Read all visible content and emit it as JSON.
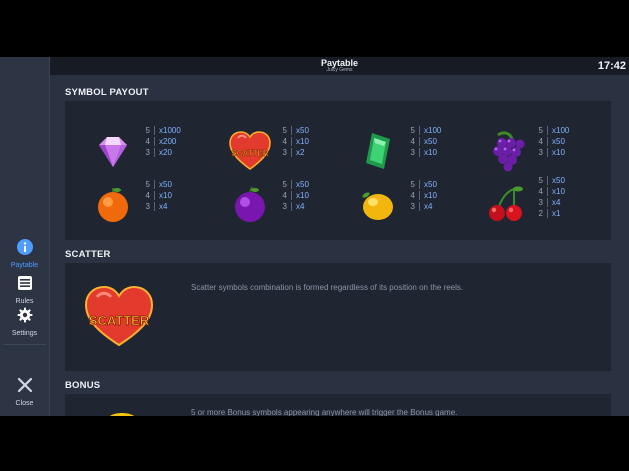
{
  "header": {
    "title": "Paytable",
    "subtitle": "Juicy Gems",
    "time": "17:42"
  },
  "sidebar": {
    "items": [
      {
        "label": "Paytable",
        "icon": "info-icon"
      },
      {
        "label": "Rules",
        "icon": "rules-icon"
      },
      {
        "label": "Settings",
        "icon": "gear-icon"
      }
    ],
    "close_label": "Close"
  },
  "sections": {
    "payout_title": "SYMBOL PAYOUT",
    "scatter_title": "SCATTER",
    "bonus_title": "BONUS"
  },
  "symbols": [
    {
      "name": "diamond",
      "pays": [
        {
          "count": "5",
          "mult": "x1000"
        },
        {
          "count": "4",
          "mult": "x200"
        },
        {
          "count": "3",
          "mult": "x20"
        }
      ]
    },
    {
      "name": "scatter-heart",
      "badge": "SCATTER",
      "pays": [
        {
          "count": "5",
          "mult": "x50"
        },
        {
          "count": "4",
          "mult": "x10"
        },
        {
          "count": "3",
          "mult": "x2"
        }
      ]
    },
    {
      "name": "emerald",
      "pays": [
        {
          "count": "5",
          "mult": "x100"
        },
        {
          "count": "4",
          "mult": "x50"
        },
        {
          "count": "3",
          "mult": "x10"
        }
      ]
    },
    {
      "name": "grapes",
      "pays": [
        {
          "count": "5",
          "mult": "x100"
        },
        {
          "count": "4",
          "mult": "x50"
        },
        {
          "count": "3",
          "mult": "x10"
        }
      ]
    },
    {
      "name": "orange",
      "pays": [
        {
          "count": "5",
          "mult": "x50"
        },
        {
          "count": "4",
          "mult": "x10"
        },
        {
          "count": "3",
          "mult": "x4"
        }
      ]
    },
    {
      "name": "plum",
      "pays": [
        {
          "count": "5",
          "mult": "x50"
        },
        {
          "count": "4",
          "mult": "x10"
        },
        {
          "count": "3",
          "mult": "x4"
        }
      ]
    },
    {
      "name": "lemon",
      "pays": [
        {
          "count": "5",
          "mult": "x50"
        },
        {
          "count": "4",
          "mult": "x10"
        },
        {
          "count": "3",
          "mult": "x4"
        }
      ]
    },
    {
      "name": "cherries",
      "pays": [
        {
          "count": "5",
          "mult": "x50"
        },
        {
          "count": "4",
          "mult": "x10"
        },
        {
          "count": "3",
          "mult": "x4"
        },
        {
          "count": "2",
          "mult": "x1"
        }
      ]
    }
  ],
  "scatter": {
    "badge": "SCATTER",
    "description": "Scatter symbols combination is formed regardless of its position on the reels."
  },
  "bonus": {
    "description": "5 or more Bonus symbols appearing anywhere will trigger the Bonus game."
  },
  "colors": {
    "accent": "#4f9dff",
    "multiplier": "#7fb3ff",
    "panel": "#1f2531",
    "background": "#2a3140"
  }
}
